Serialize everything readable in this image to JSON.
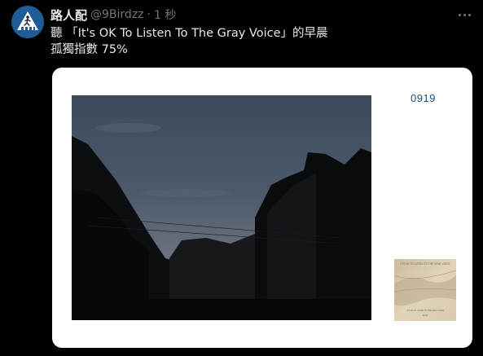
{
  "tweet": {
    "display_name": "路人配",
    "handle": "@9Birdzz",
    "separator": "·",
    "timestamp": "1 秒",
    "text_line1": "聽 「It's OK To Listen To The Gray Voice」的早晨",
    "text_line2": "孤獨指數 75%"
  },
  "card": {
    "date_label": "0919",
    "album_cover_title": "IT'S OK TO LISTEN TO THE GRAY VOICE",
    "album_cover_caption": "IT'S OK TO LISTEN TO THE GRAY VOICE",
    "album_cover_artist": "ECM"
  },
  "icons": {
    "avatar": "pedestrian-crossing-icon",
    "more": "more-horizontal-icon"
  },
  "colors": {
    "background": "#000000",
    "text_primary": "#e7e9ea",
    "text_secondary": "#71767b",
    "avatar_bg": "#1f5c95",
    "card_bg": "#ffffff",
    "date_label": "#1d4e7a"
  }
}
